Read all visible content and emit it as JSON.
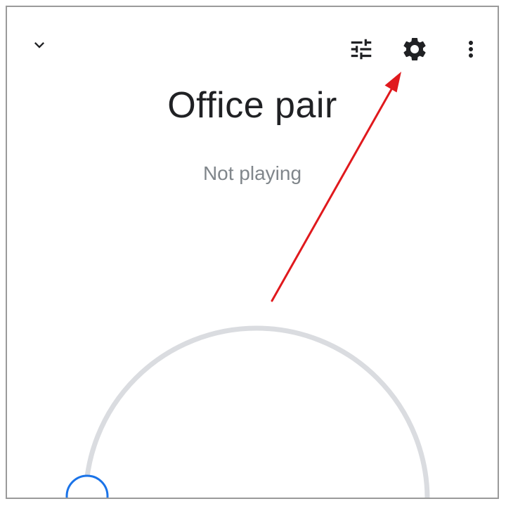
{
  "header": {
    "collapse_icon": "chevron-down-icon",
    "equalizer_icon": "tune-icon",
    "settings_icon": "gear-icon",
    "more_icon": "more-vert-icon"
  },
  "speaker_group": {
    "name": "Office pair",
    "status": "Not playing"
  },
  "volume": {
    "track_color": "#dadce0",
    "handle_color": "#1a73e8"
  },
  "annotation": {
    "arrow_color": "#e0191d",
    "points_to": "settings-button"
  },
  "colors": {
    "text_primary": "#202124",
    "text_secondary": "#80868b",
    "icon": "#202124"
  }
}
